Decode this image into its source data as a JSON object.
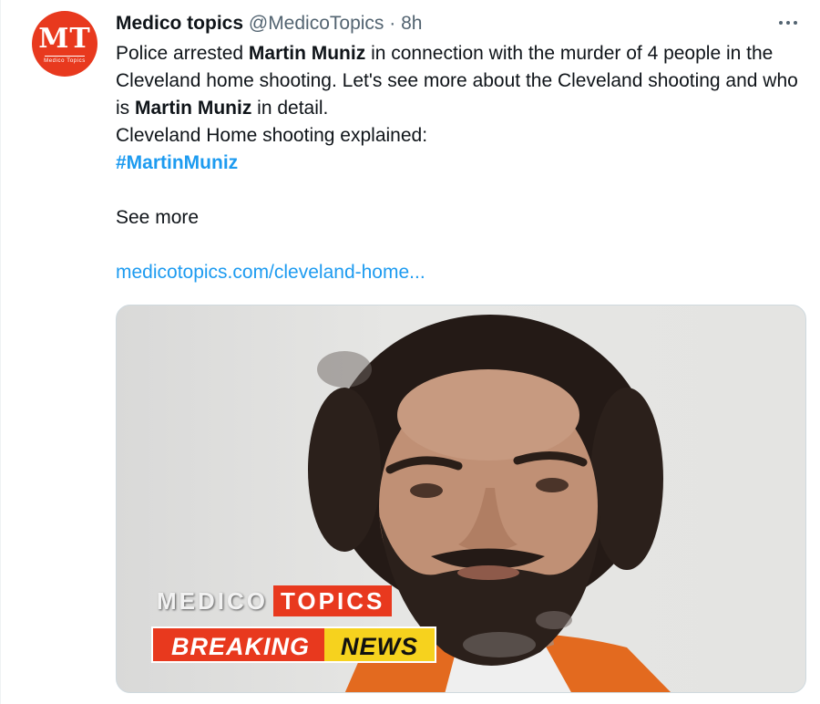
{
  "author": {
    "avatar_initials": "MT",
    "avatar_subtitle": "Medico Topics",
    "display_name": "Medico topics",
    "handle": "@MedicoTopics",
    "separator": "·",
    "timestamp": "8h"
  },
  "more_menu": {
    "icon": "more-horizontal-icon"
  },
  "tweet": {
    "line1_pre": "Police arrested ",
    "line1_bold": "Martin Muniz",
    "line1_post": " in connection with the murder of 4 people in the Cleveland home shooting. Let's see more about the Cleveland shooting and who is ",
    "line2_bold": "Martin Muniz",
    "line2_post": " in detail.",
    "line3": "Cleveland Home shooting explained:",
    "hashtag": "#MartinMuniz",
    "see_more": "See more",
    "link": "medicotopics.com/cleveland-home..."
  },
  "media": {
    "brand_left": "MEDICO",
    "brand_right": "TOPICS",
    "breaking_left": "BREAKING",
    "breaking_right": "NEWS"
  },
  "colors": {
    "accent": "#1d9bf0",
    "brand_red": "#e8391e",
    "news_yellow": "#f6d21e"
  }
}
